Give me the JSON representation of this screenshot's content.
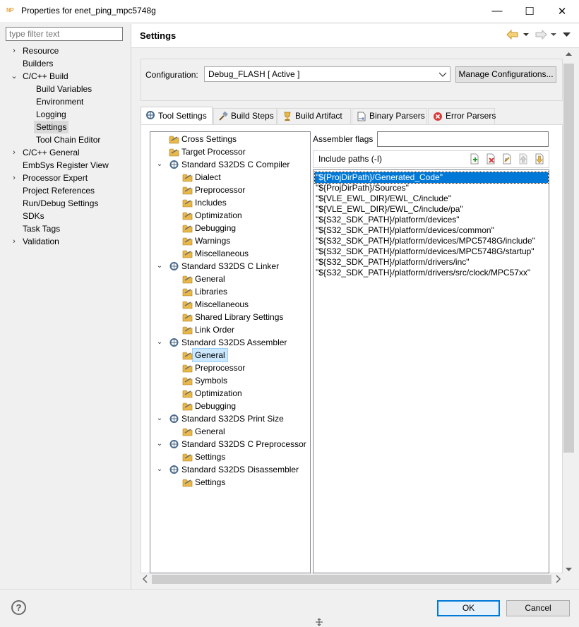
{
  "window": {
    "logo": "NP",
    "title": "Properties for enet_ping_mpc5748g",
    "min_glyph": "—",
    "max_glyph": "☐",
    "close_glyph": "✕"
  },
  "filter": {
    "placeholder": "type filter text"
  },
  "nav": {
    "items": [
      {
        "label": "Resource",
        "expander": "›"
      },
      {
        "label": "Builders"
      },
      {
        "label": "C/C++ Build",
        "expander": "⌄"
      },
      {
        "label": "Build Variables"
      },
      {
        "label": "Environment"
      },
      {
        "label": "Logging"
      },
      {
        "label": "Settings"
      },
      {
        "label": "Tool Chain Editor"
      },
      {
        "label": "C/C++ General",
        "expander": "›"
      },
      {
        "label": "EmbSys Register View"
      },
      {
        "label": "Processor Expert",
        "expander": "›"
      },
      {
        "label": "Project References"
      },
      {
        "label": "Run/Debug Settings"
      },
      {
        "label": "SDKs"
      },
      {
        "label": "Task Tags"
      },
      {
        "label": "Validation",
        "expander": "›"
      }
    ]
  },
  "page": {
    "title": "Settings"
  },
  "config": {
    "label": "Configuration:",
    "value": "Debug_FLASH  [ Active ]",
    "manage_label": "Manage Configurations..."
  },
  "tabs": [
    {
      "label": "Tool Settings"
    },
    {
      "label": "Build Steps"
    },
    {
      "label": "Build Artifact"
    },
    {
      "label": "Binary Parsers"
    },
    {
      "label": "Error Parsers"
    }
  ],
  "tool_tree": [
    {
      "label": "Cross Settings"
    },
    {
      "label": "Target Processor"
    },
    {
      "label": "Standard S32DS C Compiler"
    },
    {
      "label": "Dialect"
    },
    {
      "label": "Preprocessor"
    },
    {
      "label": "Includes"
    },
    {
      "label": "Optimization"
    },
    {
      "label": "Debugging"
    },
    {
      "label": "Warnings"
    },
    {
      "label": "Miscellaneous"
    },
    {
      "label": "Standard S32DS C Linker"
    },
    {
      "label": "General"
    },
    {
      "label": "Libraries"
    },
    {
      "label": "Miscellaneous"
    },
    {
      "label": "Shared Library Settings"
    },
    {
      "label": "Link Order"
    },
    {
      "label": "Standard S32DS Assembler"
    },
    {
      "label": "General"
    },
    {
      "label": "Preprocessor"
    },
    {
      "label": "Symbols"
    },
    {
      "label": "Optimization"
    },
    {
      "label": "Debugging"
    },
    {
      "label": "Standard S32DS Print Size"
    },
    {
      "label": "General"
    },
    {
      "label": "Standard S32DS C Preprocessor"
    },
    {
      "label": "Settings"
    },
    {
      "label": "Standard S32DS Disassembler"
    },
    {
      "label": "Settings"
    }
  ],
  "assembler": {
    "flags_label": "Assembler flags",
    "flags_value": "",
    "include_title": "Include paths (-I)",
    "include_paths": [
      "\"${ProjDirPath}/Generated_Code\"",
      "\"${ProjDirPath}/Sources\"",
      "\"${VLE_EWL_DIR}/EWL_C/include\"",
      "\"${VLE_EWL_DIR}/EWL_C/include/pa\"",
      "\"${S32_SDK_PATH}/platform/devices\"",
      "\"${S32_SDK_PATH}/platform/devices/common\"",
      "\"${S32_SDK_PATH}/platform/devices/MPC5748G/include\"",
      "\"${S32_SDK_PATH}/platform/devices/MPC5748G/startup\"",
      "\"${S32_SDK_PATH}/platform/drivers/inc\"",
      "\"${S32_SDK_PATH}/platform/drivers/src/clock/MPC57xx\""
    ]
  },
  "buttons": {
    "help": "?",
    "ok": "OK",
    "cancel": "Cancel"
  },
  "colors": {
    "selection_blue": "#0078d7",
    "tree_selection": "#cce8ff",
    "folder_yellow": "#e8b84a"
  }
}
